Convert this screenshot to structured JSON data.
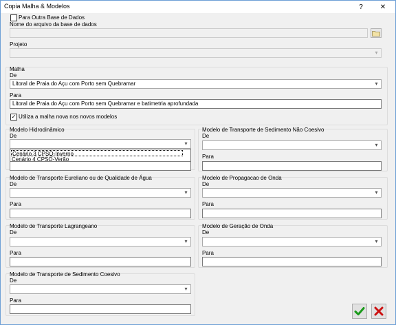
{
  "window": {
    "title": "Copia Malha & Modelos",
    "help_label": "?",
    "close_label": "✕"
  },
  "database": {
    "checkbox_label": "Para Outra Base de Dados",
    "file_label": "Nome do arquivo da base de dados",
    "project_label": "Projeto"
  },
  "malha": {
    "group_label": "Malha",
    "de_label": "De",
    "de_value": "Litoral de Praia do Açu com Porto sem Quebramar",
    "para_label": "Para",
    "para_value": "Litoral de Praia do Açu com Porto sem Quebramar e batimetria aprofundada",
    "use_new_label": "Utiliza a malha nova nos novos modelos",
    "use_new_checked": "✓"
  },
  "hidro": {
    "group_label": "Modelo Hidrodinâmico",
    "de_label": "De",
    "options": [
      "Cenário 3 CPSQ-Inverno",
      "Cenário 4 CPSQ-Verão"
    ],
    "para_label": ""
  },
  "sed_nao_coesivo": {
    "group_label": "Modelo de Transporte de Sedimento Não Coesivo",
    "de_label": "De",
    "para_label": "Para"
  },
  "euleriano": {
    "group_label": "Modelo de Transporte Eureliano ou de Qualidade de Água",
    "de_label": "De",
    "para_label": "Para"
  },
  "propagacao": {
    "group_label": "Modelo de Propagacao de Onda",
    "de_label": "De",
    "para_label": "Para"
  },
  "lagrangeano": {
    "group_label": "Modelo de Transporte Lagrangeano",
    "de_label": "De",
    "para_label": "Para"
  },
  "geracao": {
    "group_label": "Modelo de Geração de Onda",
    "de_label": "De",
    "para_label": "Para"
  },
  "sed_coesivo": {
    "group_label": "Modelo de Transporte de Sedimento Coesivo",
    "de_label": "De",
    "para_label": "Para"
  },
  "icons": {
    "ok": "check-icon",
    "cancel": "x-icon",
    "browse": "folder-icon",
    "dropdown": "chevron-down-icon"
  },
  "colors": {
    "ok": "#1a9a1a",
    "cancel": "#cc1111",
    "title_border": "#6d9fd6"
  }
}
